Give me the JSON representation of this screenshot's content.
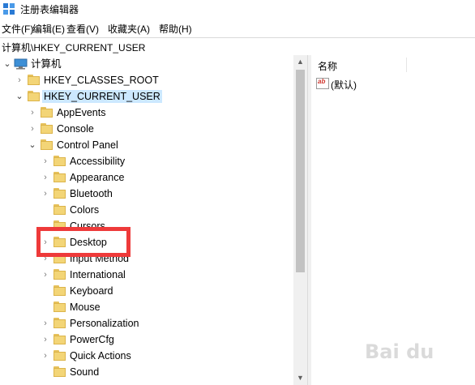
{
  "window": {
    "title": "注册表编辑器"
  },
  "menu": {
    "file": "文件(F)",
    "edit": "编辑(E)",
    "view": "查看(V)",
    "favorites": "收藏夹(A)",
    "help": "帮助(H)"
  },
  "address": {
    "path": "计算机\\HKEY_CURRENT_USER"
  },
  "tree": {
    "root": "计算机",
    "items": [
      {
        "label": "HKEY_CLASSES_ROOT",
        "expander": "closed"
      },
      {
        "label": "HKEY_CURRENT_USER",
        "expander": "open",
        "selected": true
      },
      {
        "label": "AppEvents",
        "expander": "closed"
      },
      {
        "label": "Console",
        "expander": "closed"
      },
      {
        "label": "Control Panel",
        "expander": "open"
      },
      {
        "label": "Accessibility",
        "expander": "closed"
      },
      {
        "label": "Appearance",
        "expander": "closed"
      },
      {
        "label": "Bluetooth",
        "expander": "closed"
      },
      {
        "label": "Colors",
        "expander": "none"
      },
      {
        "label": "Cursors",
        "expander": "none"
      },
      {
        "label": "Desktop",
        "expander": "closed"
      },
      {
        "label": "Input Method",
        "expander": "closed"
      },
      {
        "label": "International",
        "expander": "closed"
      },
      {
        "label": "Keyboard",
        "expander": "none"
      },
      {
        "label": "Mouse",
        "expander": "none"
      },
      {
        "label": "Personalization",
        "expander": "closed"
      },
      {
        "label": "PowerCfg",
        "expander": "closed"
      },
      {
        "label": "Quick Actions",
        "expander": "closed"
      },
      {
        "label": "Sound",
        "expander": "none"
      }
    ]
  },
  "values_pane": {
    "column_name": "名称",
    "rows": [
      {
        "name": "(默认)",
        "icon": "ab-string-icon"
      }
    ]
  },
  "annotation": {
    "highlight_color": "#ee3a3a",
    "highlight_target": "Desktop"
  },
  "watermark": {
    "text": "Bai du"
  }
}
